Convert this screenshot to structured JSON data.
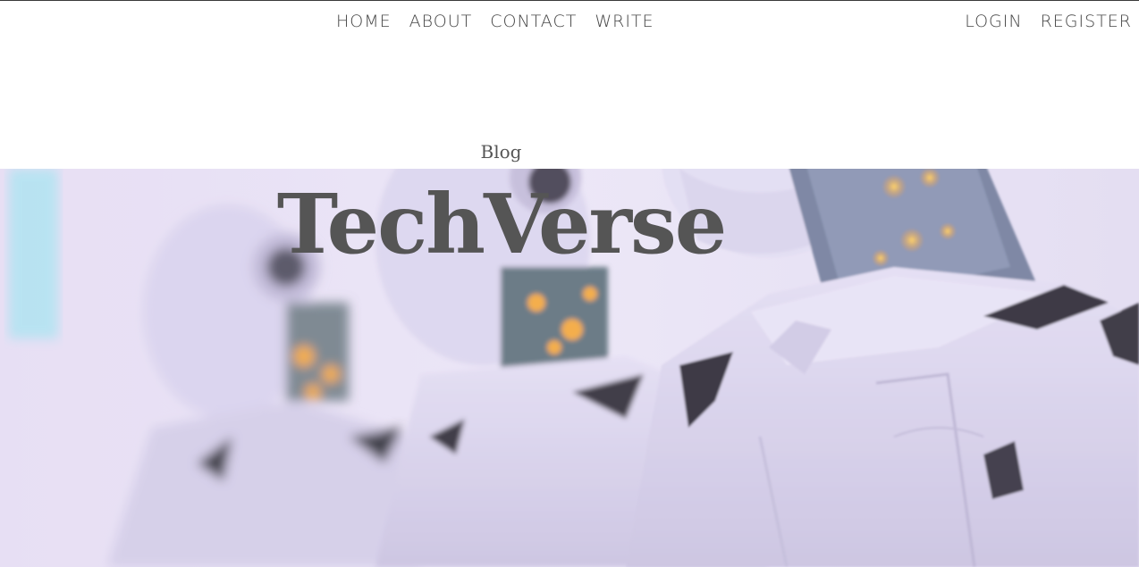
{
  "nav": {
    "items": [
      {
        "label": "HOME"
      },
      {
        "label": "ABOUT"
      },
      {
        "label": "CONTACT"
      },
      {
        "label": "WRITE"
      }
    ]
  },
  "auth": {
    "login_label": "LOGIN",
    "register_label": "REGISTER"
  },
  "header": {
    "subtitle": "Blog",
    "title": "TechVerse"
  },
  "hero": {
    "subject": "row of white humanoid robots",
    "palette": {
      "background": "#e9e2f6",
      "robot_body": "#dcd6ee",
      "shadow": "#8f88a8",
      "dark": "#2a2732",
      "glow": "#f3a33a",
      "cyan": "#7fe8f2"
    }
  }
}
